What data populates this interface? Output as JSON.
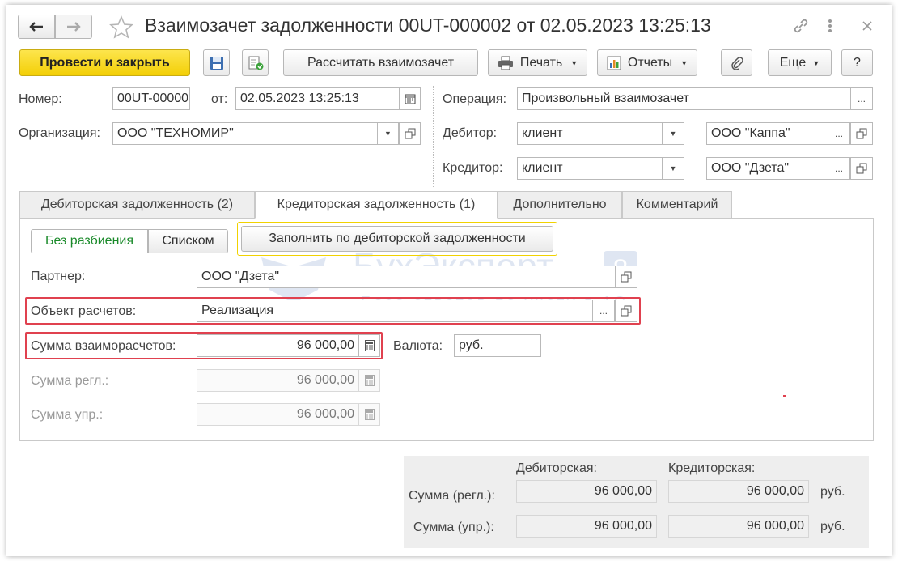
{
  "window": {
    "title": "Взаимозачет задолженности 00UT-000002 от 02.05.2023 13:25:13"
  },
  "toolbar": {
    "post_close_label": "Провести и закрыть",
    "calc_label": "Рассчитать взаимозачет",
    "print_label": "Печать",
    "reports_label": "Отчеты",
    "more_label": "Еще",
    "help_label": "?"
  },
  "header": {
    "number_label": "Номер:",
    "number_value": "00UT-00000",
    "date_label": "от:",
    "date_value": "02.05.2023 13:25:13",
    "org_label": "Организация:",
    "org_value": "ООО \"ТЕХНОМИР\"",
    "operation_label": "Операция:",
    "operation_value": "Произвольный взаимозачет",
    "debtor_label": "Дебитор:",
    "debtor_type": "клиент",
    "debtor_value": "ООО \"Каппа\"",
    "creditor_label": "Кредитор:",
    "creditor_type": "клиент",
    "creditor_value": "ООО \"Дзета\""
  },
  "tabs": [
    {
      "label": "Дебиторская задолженность (2)"
    },
    {
      "label": "Кредиторская задолженность (1)"
    },
    {
      "label": "Дополнительно"
    },
    {
      "label": "Комментарий"
    }
  ],
  "panel": {
    "mode_split_label": "Без разбиения",
    "mode_list_label": "Списком",
    "fill_button_label": "Заполнить по дебиторской задолженности",
    "partner_label": "Партнер:",
    "partner_value": "ООО \"Дзета\"",
    "object_label": "Объект расчетов:",
    "object_value": "Реализация",
    "amount_label": "Сумма взаиморасчетов:",
    "amount_value": "96 000,00",
    "currency_label": "Валюта:",
    "currency_value": "руб.",
    "amount_reg_label": "Сумма регл.:",
    "amount_reg_value": "96 000,00",
    "amount_mgmt_label": "Сумма упр.:",
    "amount_mgmt_value": "96 000,00"
  },
  "watermark": {
    "brand": "БухЭксперт",
    "brand_digit": "8",
    "tagline": "База ответов по учету в 1С"
  },
  "totals": {
    "debit_header": "Дебиторская:",
    "credit_header": "Кредиторская:",
    "rows": [
      {
        "label": "Сумма (регл.):",
        "debit": "96 000,00",
        "credit": "96 000,00",
        "currency": "руб."
      },
      {
        "label": "Сумма (упр.):",
        "debit": "96 000,00",
        "credit": "96 000,00",
        "currency": "руб."
      }
    ]
  },
  "colors": {
    "primary": "#f3cf06",
    "highlight": "#e0414f",
    "active_mode": "#1a8a2a"
  }
}
